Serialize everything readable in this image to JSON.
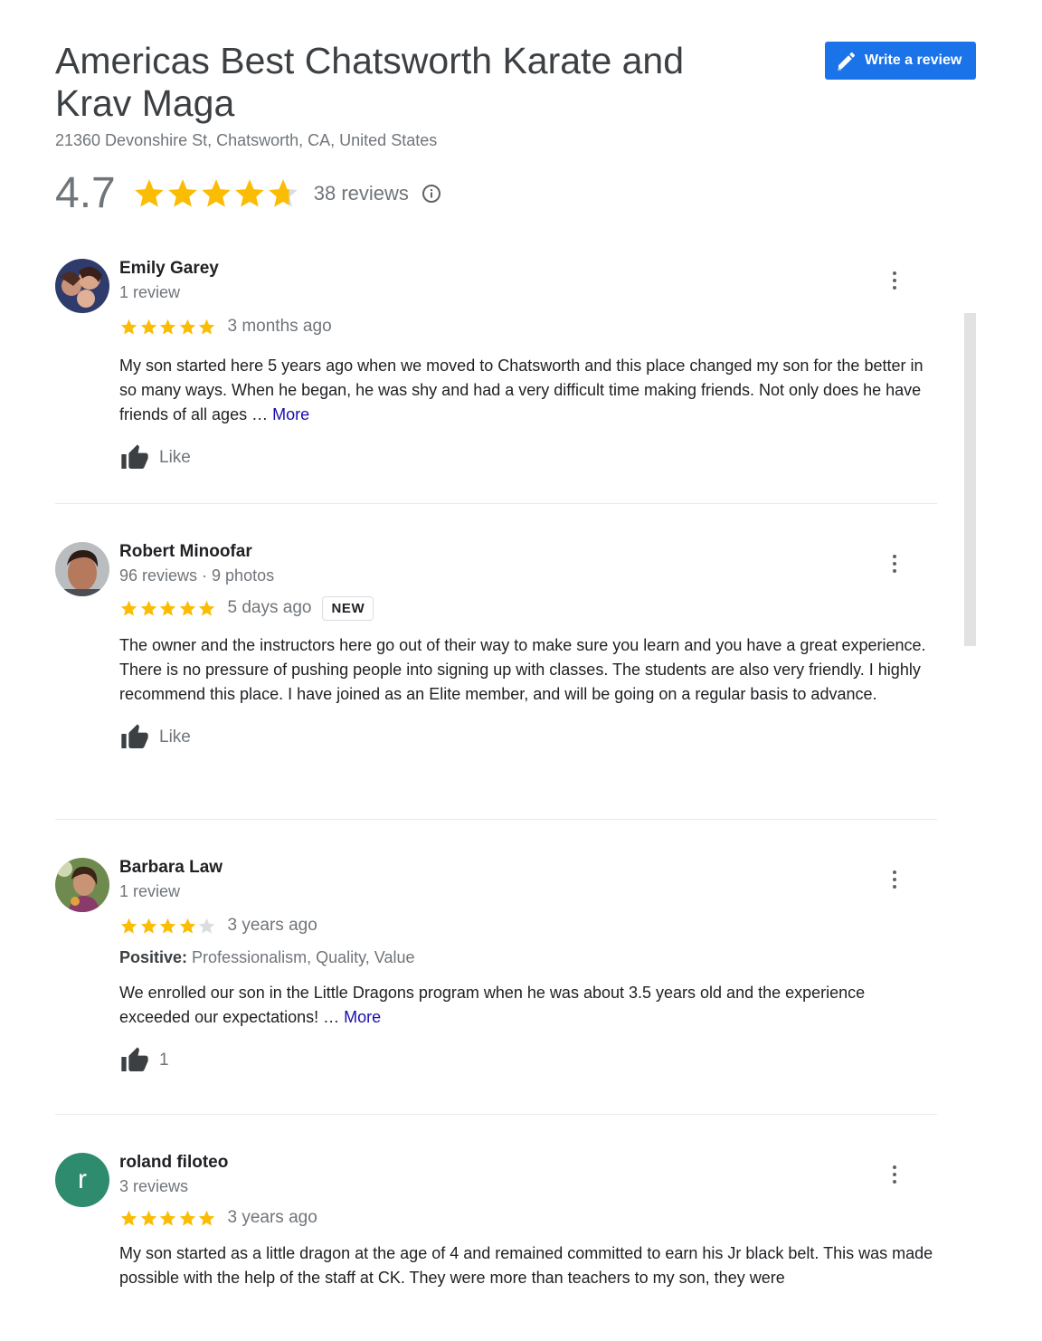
{
  "place": {
    "title": "Americas Best Chatsworth Karate and Krav Maga",
    "address": "21360 Devonshire St, Chatsworth, CA, United States",
    "rating": "4.7",
    "rating_value": 4.7,
    "reviews_count": "38 reviews",
    "write_review_label": "Write a review"
  },
  "colors": {
    "accent": "#1a73e8",
    "star": "#fbbc04",
    "star_empty": "#dadce0",
    "link": "#1a0dab"
  },
  "reviews": [
    {
      "name": "Emily Garey",
      "meta": "1 review",
      "stars": 5,
      "date": "3 months ago",
      "text": "My son started here 5 years ago when we moved to Chatsworth and this place changed my son for the better in so many ways. When he began, he was shy and had a very difficult time making friends. Not only does he have friends of all ages … ",
      "more": "More",
      "like": "Like"
    },
    {
      "name": "Robert Minoofar",
      "meta": "96 reviews · 9 photos",
      "stars": 5,
      "date": "5 days ago",
      "badge": "NEW",
      "text": "The owner and the instructors here go out of their way to make sure you learn and you have a great experience. There is no pressure of pushing people into signing up with classes. The students are also very friendly. I highly recommend this place. I have joined as an Elite member, and will be going on a regular basis to advance.",
      "like": "Like"
    },
    {
      "name": "Barbara Law",
      "meta": "1 review",
      "stars": 4,
      "date": "3 years ago",
      "positive_label": "Positive:",
      "positive_values": "Professionalism, Quality, Value",
      "text": "We enrolled our son in the Little Dragons program when he was about 3.5 years old and the experience exceeded our expectations! … ",
      "more": "More",
      "like": "1"
    },
    {
      "name": "roland filoteo",
      "avatar_letter": "r",
      "meta": "3 reviews",
      "stars": 5,
      "date": "3 years ago",
      "text": "My son started as a little dragon at the age of 4 and remained committed to earn his Jr black belt. This was made possible with the help of the staff at CK. They were more than teachers to my son, they were"
    }
  ]
}
